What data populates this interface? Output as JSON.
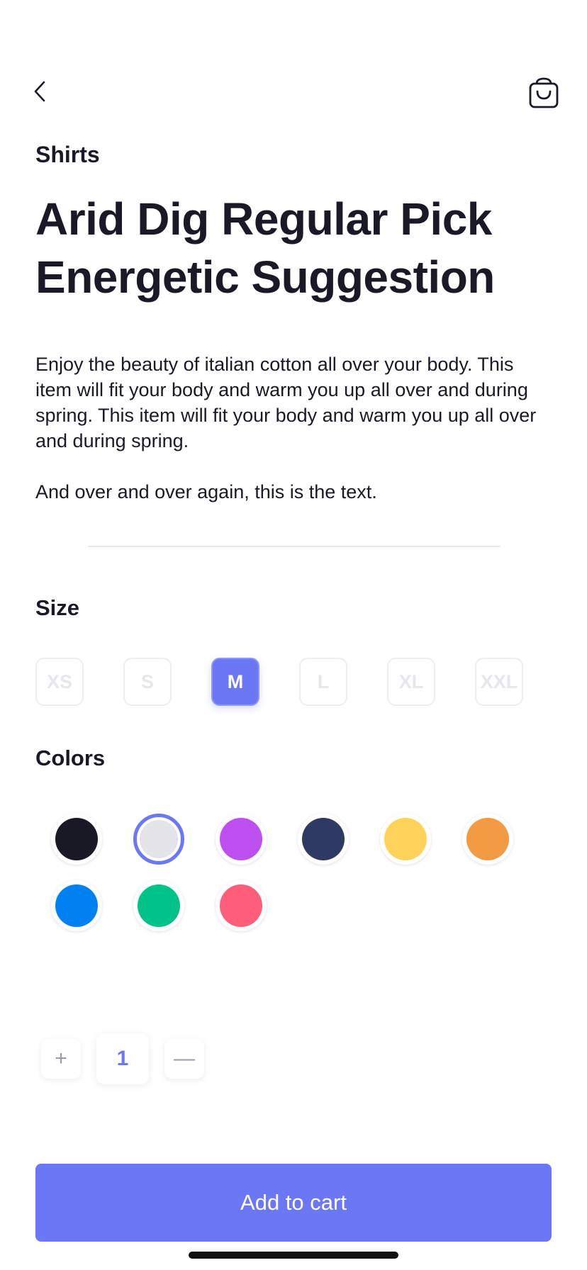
{
  "header": {
    "back_icon": "chevron-left-icon",
    "cart_icon": "shopping-bag-icon"
  },
  "product": {
    "category": "Shirts",
    "title": "Arid Dig Regular Pick Energetic Suggestion",
    "description": [
      "Enjoy the beauty of italian cotton all over your body. This item will fit your body and warm you up all over and during spring. This item will fit your body and warm you up all over and during spring.",
      "And over and over again, this is the text."
    ]
  },
  "size_section": {
    "label": "Size",
    "options": [
      "XS",
      "S",
      "M",
      "L",
      "XL",
      "XXL"
    ],
    "selected": "M"
  },
  "colors_section": {
    "label": "Colors",
    "options": [
      "#181925",
      "#e3e3e8",
      "#bd50ee",
      "#2f3a63",
      "#ffd25a",
      "#f39a44",
      "#0081f2",
      "#00c389",
      "#ff5e7b"
    ],
    "selected_index": 1
  },
  "quantity": {
    "value": "1",
    "increment_label": "+",
    "decrement_label": "—"
  },
  "cta": {
    "label": "Add to cart"
  },
  "theme": {
    "accent": "#6b78f5",
    "text": "#1a1a26"
  }
}
